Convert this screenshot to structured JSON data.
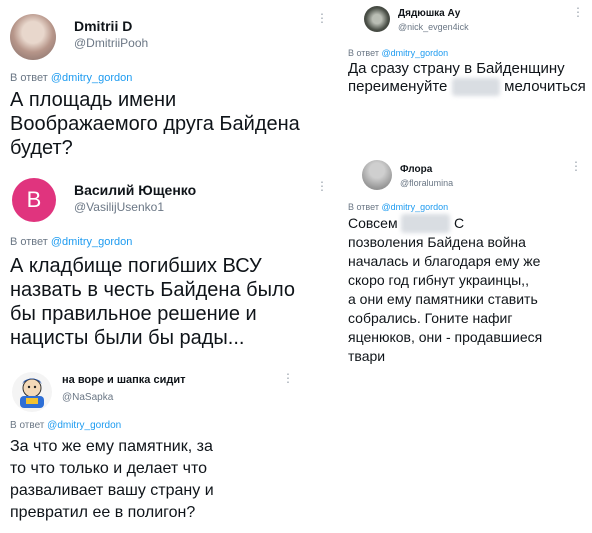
{
  "tweets": [
    {
      "name": "Dmitrii D",
      "handle": "@DmitriiPooh",
      "reply_prefix": "В ответ",
      "mention": "@dmitry_gordon",
      "lines": [
        "А площадь имени",
        "Воображаемого друга Байдена",
        "будет?"
      ]
    },
    {
      "name": "Василий Ющенко",
      "handle": "@VasilijUsenko1",
      "avatar_letter": "В",
      "reply_prefix": "В ответ",
      "mention": "@dmitry_gordon",
      "lines": [
        "А кладбище погибших ВСУ",
        "назвать в честь Байдена было",
        "бы правильное решение и",
        "нацисты были бы рады..."
      ]
    },
    {
      "name": "на воре и шапка сидит",
      "handle": "@NaSapka",
      "reply_prefix": "В ответ",
      "mention": "@dmitry_gordon",
      "lines": [
        "За что же ему памятник, за",
        "то что только и делает что",
        "разваливает вашу страну и",
        "превратил ее в полигон?"
      ]
    },
    {
      "name": "Дядюшка Ау",
      "handle": "@nick_evgen4ick",
      "reply_prefix": "В ответ",
      "mention": "@dmitry_gordon",
      "line1": "Да сразу страну в Байденщину",
      "line2a": "переименуйте",
      "line2b": "мелочиться"
    },
    {
      "name": "Флора",
      "handle": "@floralumina",
      "reply_prefix": "В ответ",
      "mention": "@dmitry_gordon",
      "line1a": "Совсем",
      "line1b": "С",
      "lines": [
        "позволения Байдена война",
        "началась и благодаря ему же",
        "скоро год гибнут украинцы,,",
        "а они ему памятники ставить",
        "собрались. Гоните нафиг",
        "яценюков, они - продавшиеся",
        "твари"
      ]
    }
  ],
  "colors": {
    "mention": "#1d9bf0",
    "avatar_pink": "#e0347e",
    "muted": "#6b7785"
  }
}
